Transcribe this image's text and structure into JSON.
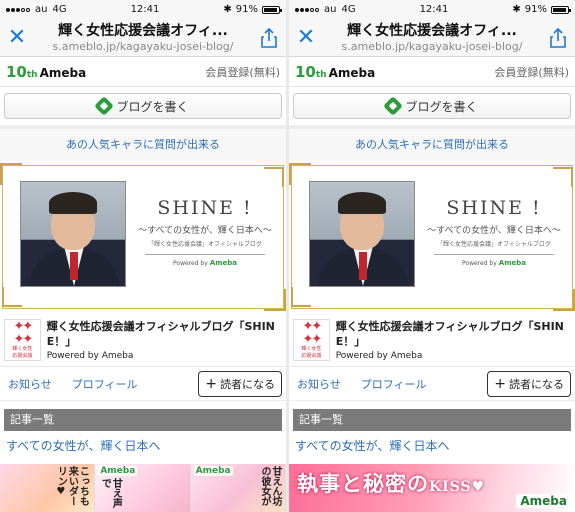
{
  "status_bar": {
    "carrier": "au",
    "network": "4G",
    "time": "12:41",
    "battery": "91%",
    "battery_level": 0.91
  },
  "browser": {
    "title": "輝く女性応援会議オフィ...",
    "url": "s.ameblo.jp/kagayaku-josei-blog/"
  },
  "ameba_header": {
    "logo_number": "10",
    "logo_suffix": "th",
    "logo_name": "Ameba",
    "register": "会員登録(無料)"
  },
  "write_button": "ブログを書く",
  "promo_link": "あの人気キャラに質問が出来る",
  "banner": {
    "title": "SHINE !",
    "subtitle": "〜すべての女性が、輝く日本へ〜",
    "small": "「輝く女性応援会議」オフィシャルブログ",
    "powered": "Powered by",
    "powered_brand": "Ameba"
  },
  "blog": {
    "icon_label_1": "輝く女性",
    "icon_label_2": "応援会議",
    "title": "輝く女性応援会議オフィシャルブログ「SHINE！」",
    "powered": "Powered by Ameba"
  },
  "links": {
    "news": "お知らせ",
    "profile": "プロフィール",
    "reader": "読者になる"
  },
  "articles_header": "記事一覧",
  "headline": "すべての女性が、輝く日本へ",
  "ad_left": {
    "tile1_text": "こっちも来いダーリン♥",
    "tile2_text": "甘え声で",
    "tile2_brand": "Ameba",
    "tile3_text": "甘えん坊の彼女が",
    "tile3_brand": "Ameba"
  },
  "ad_right": {
    "copy_main": "執事と秘密の",
    "copy_kiss": "KISS♥",
    "brand": "Ameba"
  },
  "colors": {
    "link": "#2c6fb6",
    "ameba_green": "#2a9d3a",
    "ios_blue": "#1a7ad6"
  }
}
